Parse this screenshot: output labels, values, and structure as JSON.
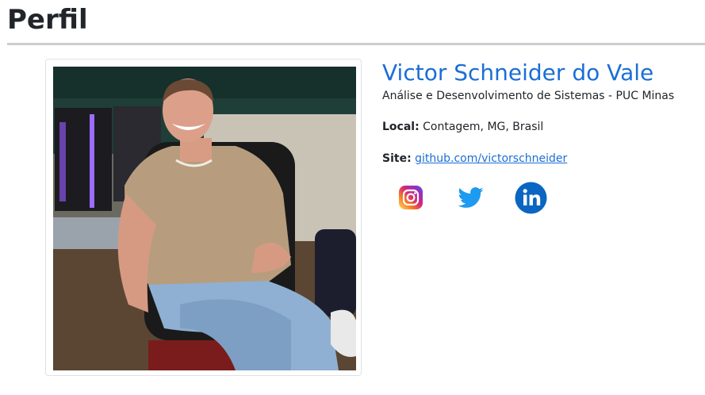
{
  "page": {
    "title": "Perfil"
  },
  "profile": {
    "name": "Victor Schneider do Vale",
    "course": "Análise e Desenvolvimento de Sistemas - PUC Minas",
    "local_label": "Local:",
    "local_value": "Contagem, MG, Brasil",
    "site_label": "Site:",
    "site_link": "github.com/victorschneider",
    "photo_icon": "profile-photo"
  },
  "social": [
    {
      "name": "instagram",
      "icon": "instagram-icon"
    },
    {
      "name": "twitter",
      "icon": "twitter-icon"
    },
    {
      "name": "linkedin",
      "icon": "linkedin-icon"
    }
  ],
  "colors": {
    "accent": "#1b6ed6",
    "rule": "#cdcdcd",
    "twitter": "#1d9bf0",
    "linkedin": "#0a66c2"
  }
}
